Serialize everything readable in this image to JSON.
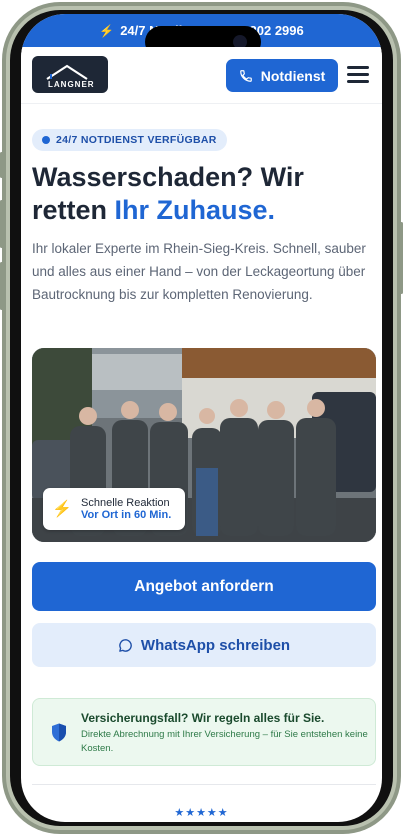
{
  "topbar": {
    "text": "24/7 Notdienst: 0171 202 2996",
    "icon": "bolt-icon"
  },
  "header": {
    "logo_text": "LANGNER",
    "notdienst_label": "Notdienst",
    "menu_icon": "hamburger-icon",
    "phone_icon": "phone-icon"
  },
  "hero": {
    "badge": "24/7 NOTDIENST VERFÜGBAR",
    "title_part1": "Wasserschaden? Wir retten ",
    "title_accent": "Ihr Zuhause.",
    "lead": "Ihr lokaler Experte im Rhein-Sieg-Kreis. Schnell, sauber und alles aus einer Hand – von der Leckageortung über Bautrocknung bis zur kompletten Renovierung."
  },
  "reaction_card": {
    "title": "Schnelle Reaktion",
    "subtitle": "Vor Ort in 60 Min."
  },
  "buttons": {
    "primary": "Angebot anfordern",
    "whatsapp": "WhatsApp schreiben"
  },
  "insurance": {
    "title": "Versicherungsfall? Wir regeln alles für Sie.",
    "text": "Direkte Abrechnung mit Ihrer Versicherung – für Sie entstehen keine Kosten."
  },
  "rating": {
    "stars": "★★★★★"
  },
  "colors": {
    "brand": "#1f66d3",
    "dark": "#1e2736",
    "accent_orange": "#f07c1b",
    "success": "#2e7a48"
  }
}
